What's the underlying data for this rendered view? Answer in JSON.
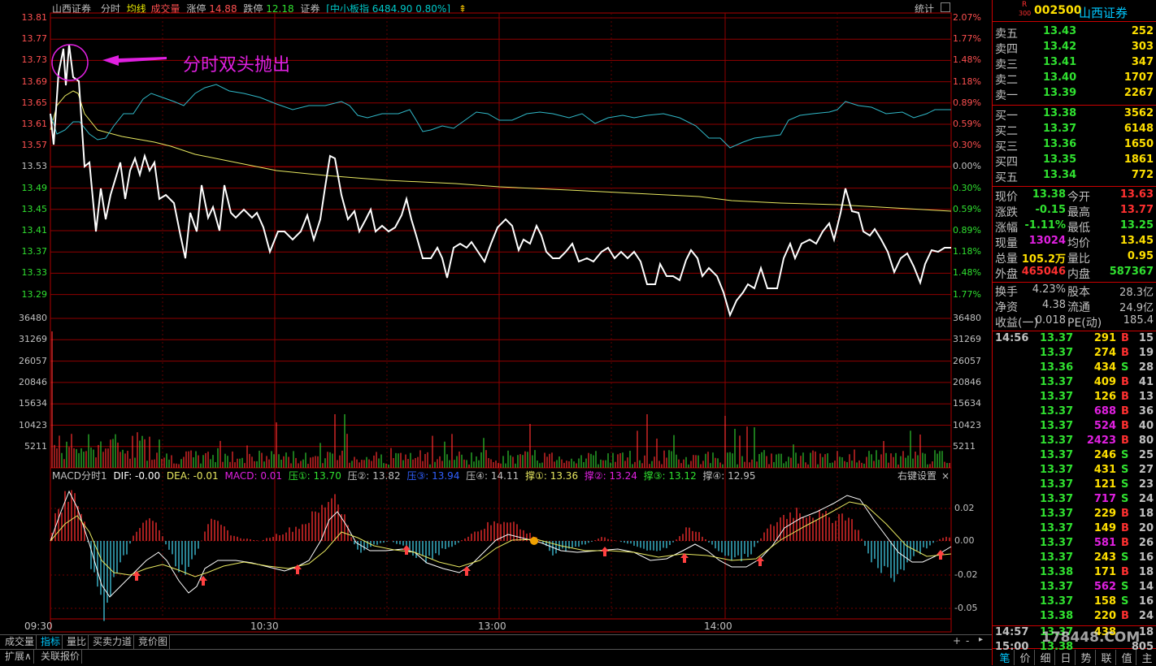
{
  "header": {
    "stock_name": "山西证券",
    "mode": "分时",
    "avg_line": "均线",
    "volume": "成交量",
    "limit_up_label": "涨停",
    "limit_up": "14.88",
    "limit_down_label": "跌停",
    "limit_down": "12.18",
    "sector": "证券",
    "index": "[中小板指 6484.90 0.80%]",
    "stats": "统计"
  },
  "annotation": "分时双头抛出",
  "price_axis": [
    "13.81",
    "13.77",
    "13.73",
    "13.69",
    "13.65",
    "13.61",
    "13.57",
    "13.53",
    "13.49",
    "13.45",
    "13.41",
    "13.37",
    "13.33",
    "13.29"
  ],
  "pct_axis": [
    "2.07%",
    "1.77%",
    "1.48%",
    "1.18%",
    "0.89%",
    "0.59%",
    "0.30%",
    "0.00%",
    "0.30%",
    "0.59%",
    "0.89%",
    "1.18%",
    "1.48%",
    "1.77%"
  ],
  "vol_axis": [
    "36480",
    "31269",
    "26057",
    "20846",
    "15634",
    "10423",
    "5211"
  ],
  "macd_header": {
    "name": "MACD分时1",
    "dif": "DIF: -0.00",
    "dea": "DEA: -0.01",
    "macd": "MACD: 0.01",
    "p1": "压①: 13.70",
    "p2": "压②: 13.82",
    "p3": "压③: 13.94",
    "p4": "压④: 14.11",
    "s1": "撑①: 13.36",
    "s2": "撑②: 13.24",
    "s3": "撑③: 13.12",
    "s4": "撑④: 12.95",
    "settings": "右键设置",
    "close": "×"
  },
  "macd_axis": [
    "0.02",
    "0.00",
    "-0.02",
    "-0.05"
  ],
  "time_axis": [
    "09:30",
    "10:30",
    "13:00",
    "14:00"
  ],
  "bottom_tabs": [
    "成交量",
    "指标",
    "量比",
    "买卖力道",
    "竞价图"
  ],
  "bottom_tabs2": [
    "扩展∧",
    "关联报价"
  ],
  "side": {
    "r_badge": "R",
    "index_badge": "300",
    "code": "002500",
    "name": "山西证券",
    "sell": [
      {
        "label": "卖五",
        "price": "13.43",
        "vol": "252"
      },
      {
        "label": "卖四",
        "price": "13.42",
        "vol": "303"
      },
      {
        "label": "卖三",
        "price": "13.41",
        "vol": "347"
      },
      {
        "label": "卖二",
        "price": "13.40",
        "vol": "1707"
      },
      {
        "label": "卖一",
        "price": "13.39",
        "vol": "2267"
      }
    ],
    "buy": [
      {
        "label": "买一",
        "price": "13.38",
        "vol": "3562"
      },
      {
        "label": "买二",
        "price": "13.37",
        "vol": "6148"
      },
      {
        "label": "买三",
        "price": "13.36",
        "vol": "1650"
      },
      {
        "label": "买四",
        "price": "13.35",
        "vol": "1861"
      },
      {
        "label": "买五",
        "price": "13.34",
        "vol": "772"
      }
    ],
    "stats": [
      {
        "l1": "现价",
        "v1": "13.38",
        "l2": "今开",
        "v2": "13.63"
      },
      {
        "l1": "涨跌",
        "v1": "-0.15",
        "l2": "最高",
        "v2": "13.77"
      },
      {
        "l1": "涨幅",
        "v1": "-1.11%",
        "l2": "最低",
        "v2": "13.25"
      },
      {
        "l1": "现量",
        "v1": "13024",
        "l2": "均价",
        "v2": "13.45"
      },
      {
        "l1": "总量",
        "v1": "105.2万",
        "l2": "量比",
        "v2": "0.95"
      },
      {
        "l1": "外盘",
        "v1": "465046",
        "l2": "内盘",
        "v2": "587367"
      }
    ],
    "stats2": [
      {
        "l1": "换手",
        "v1": "4.23%",
        "l2": "股本",
        "v2": "28.3亿"
      },
      {
        "l1": "净资",
        "v1": "4.38",
        "l2": "流通",
        "v2": "24.9亿"
      },
      {
        "l1": "收益(一)",
        "v1": "0.018",
        "l2": "PE(动)",
        "v2": "185.4"
      }
    ],
    "ticks_time": "14:56",
    "ticks": [
      {
        "p": "13.37",
        "v": "291",
        "s": "B",
        "n": "15"
      },
      {
        "p": "13.37",
        "v": "274",
        "s": "B",
        "n": "19"
      },
      {
        "p": "13.36",
        "v": "434",
        "s": "S",
        "n": "28"
      },
      {
        "p": "13.37",
        "v": "409",
        "s": "B",
        "n": "41"
      },
      {
        "p": "13.37",
        "v": "126",
        "s": "B",
        "n": "13"
      },
      {
        "p": "13.37",
        "v": "688",
        "s": "B",
        "n": "36"
      },
      {
        "p": "13.37",
        "v": "524",
        "s": "B",
        "n": "40"
      },
      {
        "p": "13.37",
        "v": "2423",
        "s": "B",
        "n": "80"
      },
      {
        "p": "13.37",
        "v": "246",
        "s": "S",
        "n": "25"
      },
      {
        "p": "13.37",
        "v": "431",
        "s": "S",
        "n": "27"
      },
      {
        "p": "13.37",
        "v": "121",
        "s": "S",
        "n": "23"
      },
      {
        "p": "13.37",
        "v": "717",
        "s": "S",
        "n": "24"
      },
      {
        "p": "13.37",
        "v": "229",
        "s": "B",
        "n": "18"
      },
      {
        "p": "13.37",
        "v": "149",
        "s": "B",
        "n": "20"
      },
      {
        "p": "13.37",
        "v": "581",
        "s": "B",
        "n": "26"
      },
      {
        "p": "13.37",
        "v": "243",
        "s": "S",
        "n": "16"
      },
      {
        "p": "13.38",
        "v": "171",
        "s": "B",
        "n": "18"
      },
      {
        "p": "13.37",
        "v": "562",
        "s": "S",
        "n": "14"
      },
      {
        "p": "13.37",
        "v": "158",
        "s": "S",
        "n": "16"
      },
      {
        "p": "13.38",
        "v": "220",
        "s": "B",
        "n": "24"
      }
    ],
    "t1457": {
      "time": "14:57",
      "p": "13.37",
      "v": "438",
      "n": "18"
    },
    "t1500": {
      "time": "15:00",
      "p": "13.38",
      "v": "",
      "n": "805"
    },
    "watermark": "178448.COM",
    "tabs": [
      "笔",
      "价",
      "细",
      "日",
      "势",
      "联",
      "值",
      "主"
    ]
  }
}
